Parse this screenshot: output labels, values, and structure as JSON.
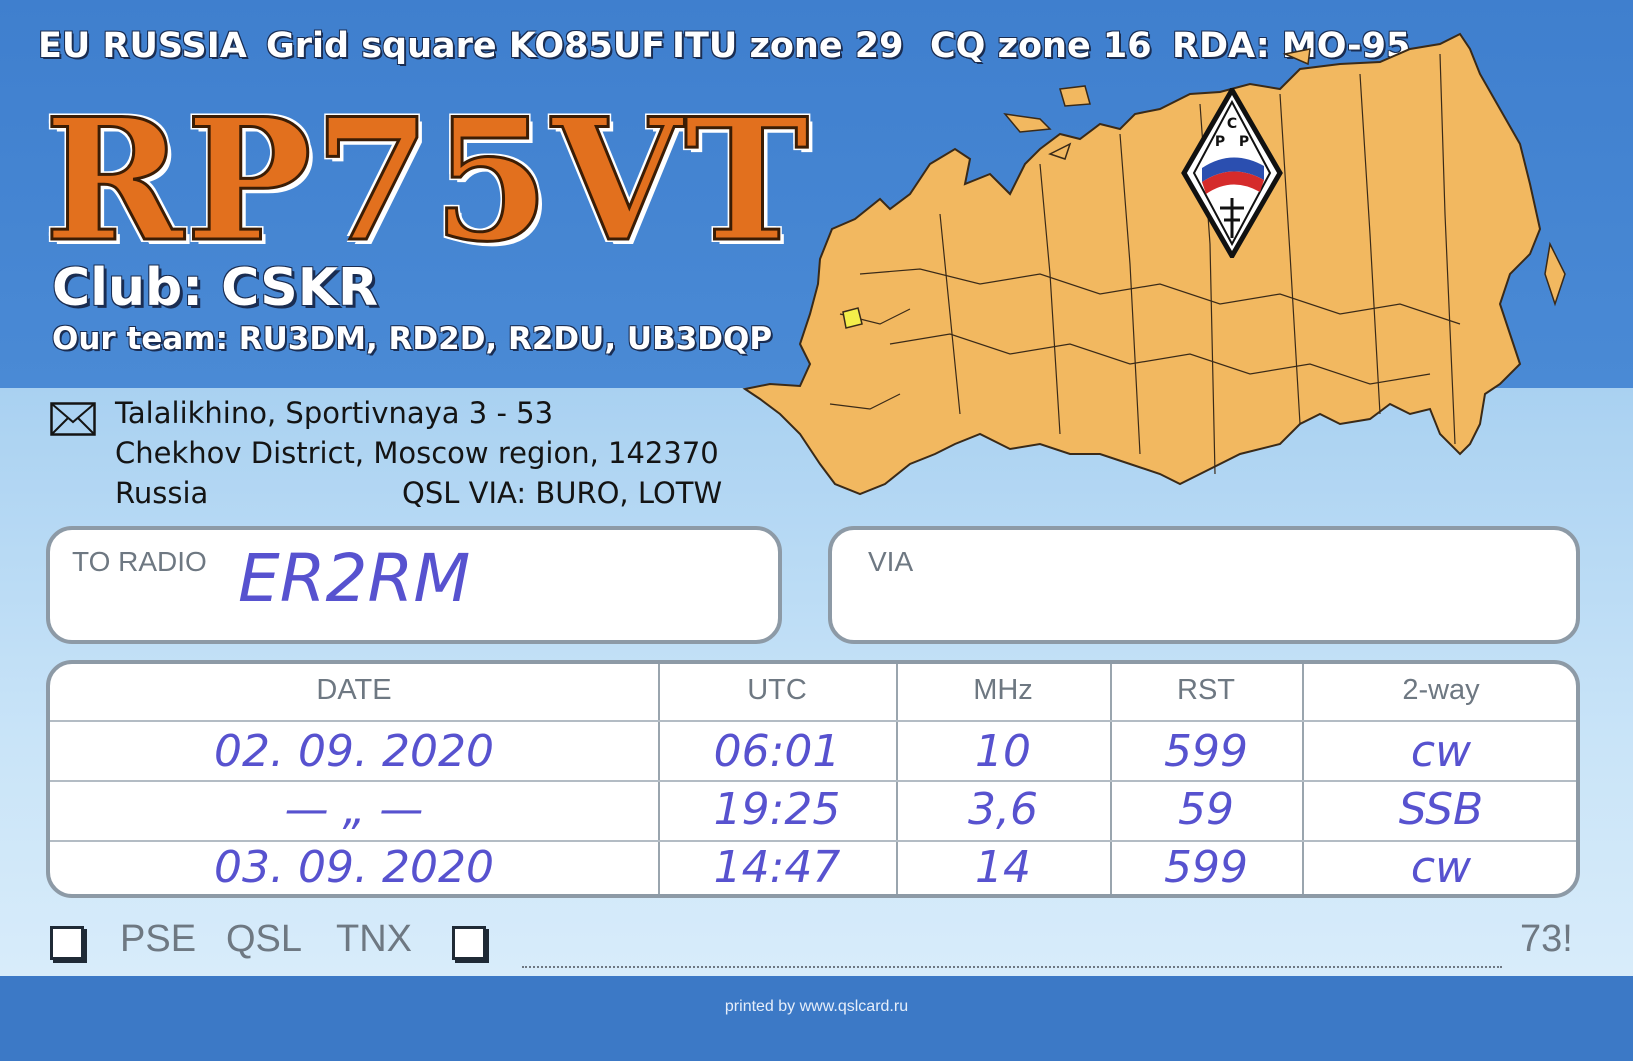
{
  "header": {
    "continent": "EU RUSSIA",
    "grid": "Grid square KO85UF",
    "itu": "ITU zone 29",
    "cq": "CQ zone 16",
    "rda": "RDA: MO-95"
  },
  "callsign": "RP75VT",
  "club": "Club: CSKR",
  "team": "Our team: RU3DM, RD2D, R2DU, UB3DQP",
  "emblem_letters": [
    "С",
    "Р",
    "Р"
  ],
  "address": {
    "line1": "Talalikhino, Sportivnaya 3 - 53",
    "line2": "Chekhov District, Moscow region, 142370",
    "line3": "Russia",
    "qsl_via": "QSL VIA: BURO, LOTW"
  },
  "to_radio": {
    "label": "TO RADIO",
    "value": "ER2RM"
  },
  "via": {
    "label": "VIA",
    "value": ""
  },
  "log": {
    "headers": [
      "DATE",
      "UTC",
      "MHz",
      "RST",
      "2-way"
    ],
    "rows": [
      [
        "02. 09. 2020",
        "06:01",
        "10",
        "599",
        "cw"
      ],
      [
        "— „ —",
        "19:25",
        "3,6",
        "59",
        "SSB"
      ],
      [
        "03. 09. 2020",
        "14:47",
        "14",
        "599",
        "cw"
      ]
    ]
  },
  "footer": {
    "pse": "PSE",
    "qsl": "QSL",
    "tnx": "TNX",
    "sign": "73!",
    "printed": "printed by www.qslcard.ru"
  },
  "colors": {
    "callsign": "#e2701e",
    "band": "#4a8ad5",
    "map_fill": "#f2b860",
    "ink": "#5752cf"
  }
}
